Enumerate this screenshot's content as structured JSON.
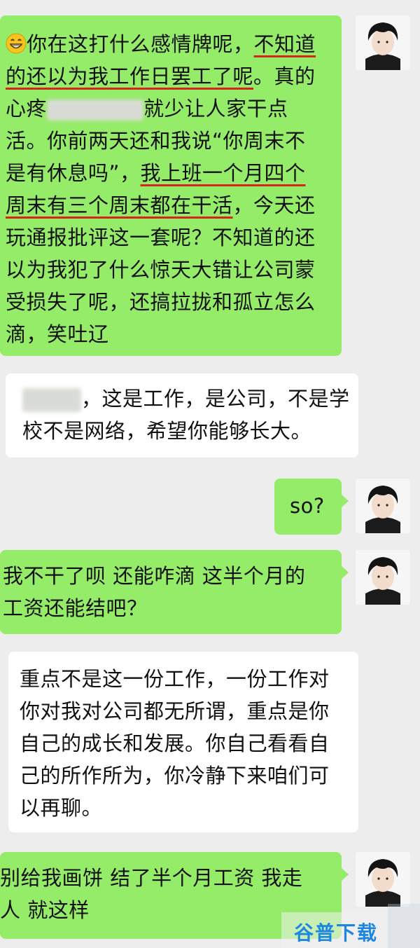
{
  "messages": [
    {
      "side": "right",
      "emoji": "grin-emoji",
      "lines": [
        [
          "你在这打什么感情牌呢，",
          "不知道"
        ],
        [
          "的还以为我工作日罢工了呢",
          "。真的"
        ],
        [
          "心疼",
          "就少让人家干点"
        ],
        [
          "活。你前两天还和我说“你周末不"
        ],
        [
          "是有休息吗”，",
          "我上班一个月四个"
        ],
        [
          "周末有三个周末都在干活",
          "，今天还"
        ],
        [
          "玩通报批评这一套呢？不知道的还"
        ],
        [
          "以为我犯了什么惊天大错让公司蒙"
        ],
        [
          "受损失了呢，还搞拉拢和孤立怎么"
        ],
        [
          "滴，笑吐辽"
        ]
      ]
    },
    {
      "side": "left",
      "lines": [
        "，这是工作，是公司，不是学",
        "校不是网络，希望你能够长大。"
      ]
    },
    {
      "side": "right",
      "lines": [
        "so?"
      ]
    },
    {
      "side": "right",
      "lines": [
        "我不干了呗 还能咋滴 这半个月的",
        "工资还能结吧？"
      ]
    },
    {
      "side": "left",
      "lines": [
        "重点不是这一份工作，一份工作对",
        "你对我对公司都无所谓，重点是你",
        "自己的成长和发展。你自己看看自",
        "己的所作所为，你冷静下来咱们可",
        "以再聊。"
      ]
    },
    {
      "side": "right",
      "lines": [
        "别给我画饼 结了半个月工资 我走",
        "人 就这样"
      ]
    }
  ],
  "watermark": {
    "text": "谷普下载"
  },
  "colors": {
    "green_bubble": "#95ec69",
    "white_bubble": "#ffffff",
    "underline": "#d6261b",
    "background": "#ededed"
  }
}
